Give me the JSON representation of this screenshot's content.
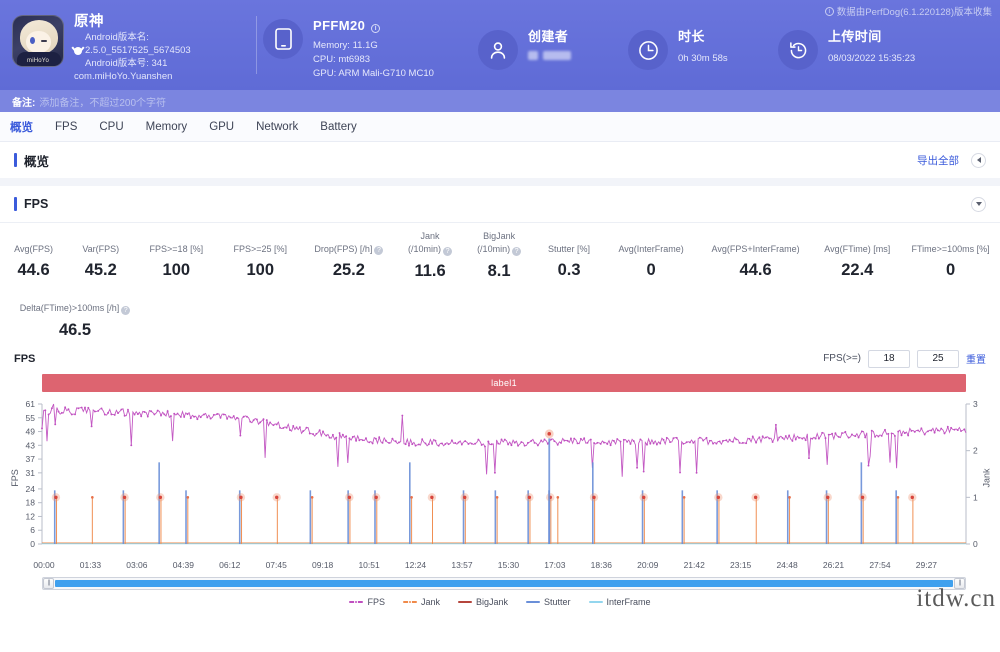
{
  "header": {
    "collect_note": "数据由PerfDog(6.1.220128)版本收集",
    "app": {
      "icon_name": "genshin-app-icon",
      "icon_brand": "miHoYo",
      "name": "原神",
      "android_version_name_label": "Android版本名:",
      "android_version_name": "2.5.0_5517525_5674503",
      "android_version_code": "Android版本号: 341",
      "package": "com.miHoYo.Yuanshen"
    },
    "device": {
      "model": "PFFM20",
      "memory": "Memory: 11.1G",
      "cpu": "CPU: mt6983",
      "gpu": "GPU: ARM Mali-G710 MC10"
    },
    "creator": {
      "title": "创建者",
      "value": ""
    },
    "duration": {
      "title": "时长",
      "value": "0h 30m 58s"
    },
    "upload": {
      "title": "上传时间",
      "value": "08/03/2022 15:35:23"
    },
    "note": {
      "label": "备注:",
      "placeholder": "添加备注，不超过200个字符"
    }
  },
  "tabs": [
    {
      "label": "概览",
      "active": true
    },
    {
      "label": "FPS",
      "active": false
    },
    {
      "label": "CPU",
      "active": false
    },
    {
      "label": "Memory",
      "active": false
    },
    {
      "label": "GPU",
      "active": false
    },
    {
      "label": "Network",
      "active": false
    },
    {
      "label": "Battery",
      "active": false
    }
  ],
  "overview_section": {
    "title": "概览",
    "export_all": "导出全部"
  },
  "fps_section": {
    "title": "FPS"
  },
  "metrics_row1": [
    {
      "label": "Avg(FPS)",
      "help": false,
      "value": "44.6"
    },
    {
      "label": "Var(FPS)",
      "help": false,
      "value": "45.2"
    },
    {
      "label": "FPS>=18 [%]",
      "help": false,
      "value": "100"
    },
    {
      "label": "FPS>=25 [%]",
      "help": false,
      "value": "100"
    },
    {
      "label": "Drop(FPS) [/h]",
      "help": true,
      "value": "25.2"
    },
    {
      "label": "Jank\n(/10min)",
      "help": true,
      "value": "11.6"
    },
    {
      "label": "BigJank\n(/10min)",
      "help": true,
      "value": "8.1"
    },
    {
      "label": "Stutter [%]",
      "help": false,
      "value": "0.3"
    },
    {
      "label": "Avg(InterFrame)",
      "help": false,
      "value": "0"
    },
    {
      "label": "Avg(FPS+InterFrame)",
      "help": false,
      "value": "44.6"
    },
    {
      "label": "Avg(FTime) [ms]",
      "help": false,
      "value": "22.4"
    },
    {
      "label": "FTime>=100ms [%]",
      "help": false,
      "value": "0"
    }
  ],
  "metrics_row2": [
    {
      "label": "Delta(FTime)>100ms [/h]",
      "help": true,
      "value": "46.5"
    }
  ],
  "chart_controls": {
    "chart_name": "FPS",
    "fps_label": "FPS(>=)",
    "threshold1": "18",
    "threshold2": "25",
    "reset": "重置",
    "label_bar_text": "label1"
  },
  "chart_data": {
    "type": "line",
    "title": "FPS",
    "xlabel": "",
    "ylabel": "FPS",
    "y2label": "Jank",
    "ylim": [
      0,
      61
    ],
    "y2lim": [
      0,
      3
    ],
    "grid": false,
    "legend_position": "bottom",
    "yticks": [
      61,
      55,
      49,
      43,
      37,
      31,
      24,
      18,
      12,
      6,
      0
    ],
    "y2ticks": [
      3,
      2,
      1,
      0
    ],
    "xticks": [
      "00:00",
      "01:33",
      "03:06",
      "04:39",
      "06:12",
      "07:45",
      "09:18",
      "10:51",
      "12:24",
      "13:57",
      "15:30",
      "17:03",
      "18:36",
      "20:09",
      "21:42",
      "23:15",
      "24:48",
      "26:21",
      "27:54",
      "29:27"
    ],
    "legend": [
      {
        "name": "FPS",
        "color": "#c050c0",
        "marker": true
      },
      {
        "name": "Jank",
        "color": "#f08a4a",
        "marker": true
      },
      {
        "name": "BigJank",
        "color": "#b5453c",
        "marker": false
      },
      {
        "name": "Stutter",
        "color": "#6a8fd8",
        "marker": false
      },
      {
        "name": "InterFrame",
        "color": "#93d6ee",
        "marker": false
      }
    ],
    "series": [
      {
        "name": "FPS",
        "color": "#c050c0",
        "note": "noisy per-second FPS trace starting near 58-60, dipping with frequent drops to 45-55 and occasional drops to 40-43, declining to ~48-52 around 07:00, flattening near 43-46 mid-run, rising slightly to 47-50 near the end",
        "x": [
          "00:00",
          "01:33",
          "03:06",
          "04:39",
          "06:12",
          "07:45",
          "09:18",
          "10:51",
          "12:24",
          "13:57",
          "15:30",
          "17:03",
          "18:36",
          "20:09",
          "21:42",
          "23:15",
          "24:48",
          "26:21",
          "27:54",
          "29:27"
        ],
        "values": [
          58,
          58,
          57,
          56,
          55,
          51,
          47,
          45,
          44,
          44,
          44,
          45,
          44,
          45,
          45,
          46,
          47,
          48,
          49,
          50
        ]
      },
      {
        "name": "Jank",
        "color": "#f08a4a",
        "note": "discrete jank markers at value 1 (right axis) plotted as vertical impulses",
        "impulse_times": [
          "00:28",
          "01:40",
          "02:46",
          "03:58",
          "04:52",
          "06:40",
          "07:52",
          "09:02",
          "10:18",
          "11:12",
          "12:22",
          "13:04",
          "14:10",
          "15:14",
          "16:20",
          "17:02",
          "17:16",
          "18:30",
          "20:10",
          "21:30",
          "22:40",
          "23:55",
          "25:02",
          "26:20",
          "27:30",
          "28:40",
          "29:10"
        ],
        "impulse_value": 1
      },
      {
        "name": "Stutter",
        "color": "#6a8fd8",
        "note": "vertical blue impulses co-located with jank events, reaching ~1.1-1.3 on Jank axis",
        "impulse_value": 1.15
      },
      {
        "name": "BigJank",
        "color": "#b5453c",
        "note": "baseline flat near 0",
        "values": [
          0,
          0,
          0,
          0,
          0,
          0,
          0,
          0,
          0,
          0,
          0,
          0,
          0,
          0,
          0,
          0,
          0,
          0,
          0,
          0
        ]
      },
      {
        "name": "InterFrame",
        "color": "#93d6ee",
        "note": "flat at 0 for whole run",
        "values": [
          0,
          0,
          0,
          0,
          0,
          0,
          0,
          0,
          0,
          0,
          0,
          0,
          0,
          0,
          0,
          0,
          0,
          0,
          0,
          0
        ]
      }
    ]
  },
  "watermark": "itdw.cn"
}
